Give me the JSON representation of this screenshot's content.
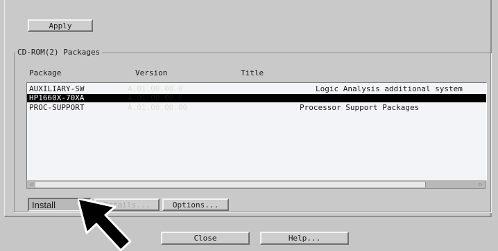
{
  "apply_label": "Apply",
  "group": {
    "title": "CD-ROM(2) Packages",
    "columns": [
      "Package",
      "Version",
      "Title"
    ],
    "rows": [
      {
        "package": "AUXILIARY-SW",
        "version": "A.01.00.00.0",
        "title": "Logic Analysis additional system"
      },
      {
        "package": "HP1660X-70XA",
        "version": "A.01.00.00.0",
        "title": "",
        "selected": true
      },
      {
        "package": "PROC-SUPPORT",
        "version": "A.01.00.00.00",
        "title": "Processor Support Packages"
      }
    ]
  },
  "buttons": {
    "install": "Install",
    "details": "Details...",
    "options": "Options..."
  },
  "footer": {
    "close": "Close",
    "help": "Help..."
  },
  "icons": {
    "cursor": "arrow-pointer-icon",
    "scroll_left": "scroll-left-arrow-icon",
    "scroll_right": "scroll-right-arrow-icon"
  },
  "colors": {
    "selection": "#000000",
    "list_background": "#f2f4f7",
    "panel": "#c9c9c9"
  }
}
